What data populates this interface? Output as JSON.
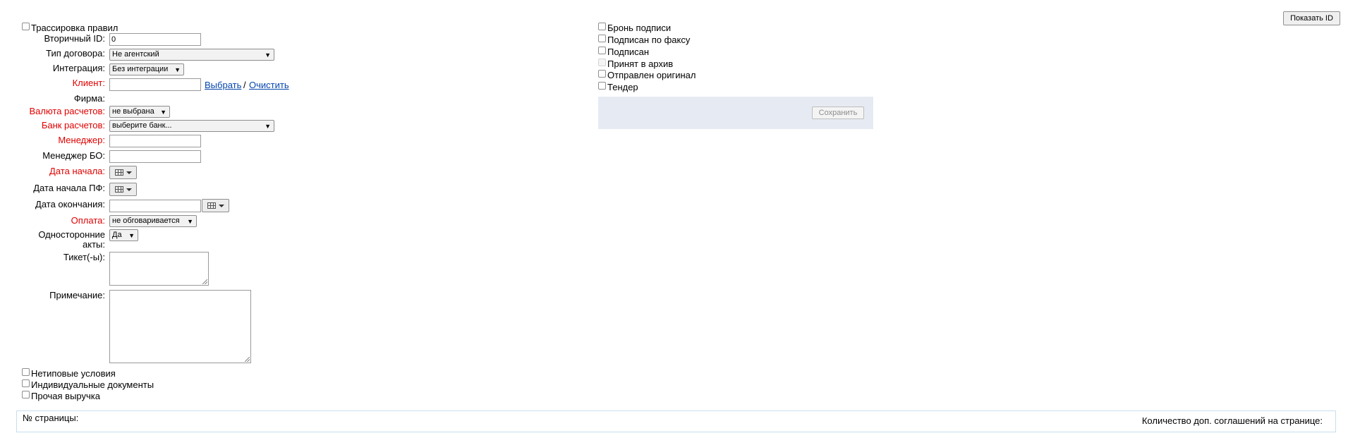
{
  "toolbar": {
    "show_id_button": "Показать ID"
  },
  "left_checkboxes": {
    "trace_rules": "Трассировка правил"
  },
  "form": {
    "secondary_id": {
      "label": "Вторичный ID:",
      "value": "0"
    },
    "contract_type": {
      "label": "Тип договора:",
      "selected": "Не агентский"
    },
    "integration": {
      "label": "Интеграция:",
      "selected": "Без интеграции"
    },
    "client": {
      "label": "Клиент:",
      "value": "",
      "select_link": "Выбрать",
      "separator": "/",
      "clear_link": "Очистить"
    },
    "firm": {
      "label": "Фирма:"
    },
    "currency": {
      "label": "Валюта расчетов:",
      "selected": "не выбрана"
    },
    "bank": {
      "label": "Банк расчетов:",
      "selected": "выберите банк..."
    },
    "manager": {
      "label": "Менеджер:",
      "value": ""
    },
    "manager_bo": {
      "label": "Менеджер БО:",
      "value": ""
    },
    "start_date": {
      "label": "Дата начала:"
    },
    "start_date_pf": {
      "label": "Дата начала ПФ:"
    },
    "end_date": {
      "label": "Дата окончания:",
      "value": ""
    },
    "payment": {
      "label": "Оплата:",
      "selected": "не обговаривается"
    },
    "one_sided_acts": {
      "label_line1": "Односторонние",
      "label_line2": "акты:",
      "selected": "Да"
    },
    "tickets": {
      "label": "Тикет(-ы):",
      "value": ""
    },
    "note": {
      "label": "Примечание:",
      "value": ""
    }
  },
  "bottom_checkboxes": {
    "nonstandard": "Нетиповые условия",
    "individual_docs": "Индивидуальные документы",
    "other_revenue": "Прочая выручка"
  },
  "right_checkboxes": {
    "reserve_signature": "Бронь подписи",
    "signed_fax": "Подписан по факсу",
    "signed": "Подписан",
    "archived": "Принят в архив",
    "original_sent": "Отправлен оригинал",
    "tender": "Тендер"
  },
  "save_panel": {
    "save_button": "Сохранить"
  },
  "footer": {
    "page_number_label": "№ страницы:",
    "agreements_count_label": "Количество доп. соглашений на странице:"
  },
  "colors": {
    "required_label": "#e00000",
    "link": "#0645ad",
    "panel_bg": "#e6ebf3",
    "footer_border": "#c7dff0"
  },
  "icons": {
    "calendar": "calendar-icon",
    "dropdown": "chevron-down-icon"
  }
}
